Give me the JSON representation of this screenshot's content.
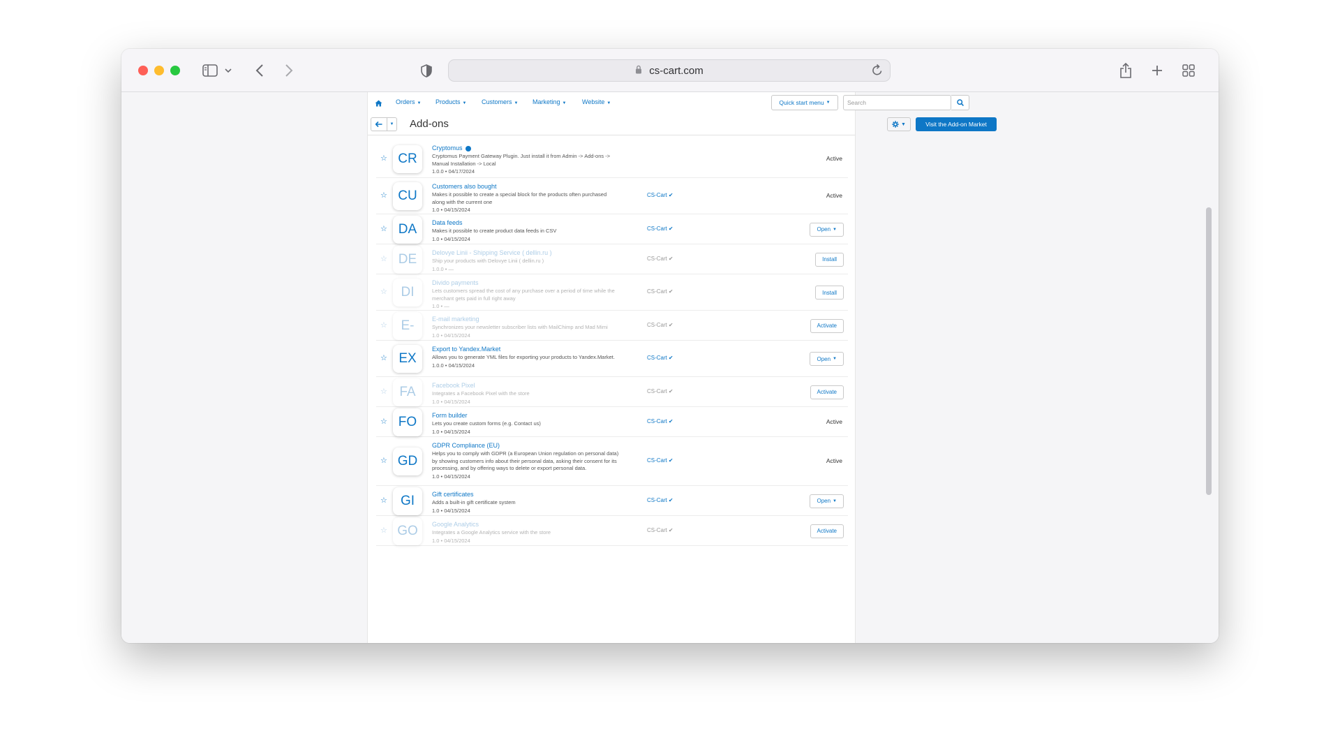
{
  "browser": {
    "url": "cs-cart.com"
  },
  "admin": {
    "nav": [
      {
        "label": "Orders"
      },
      {
        "label": "Products"
      },
      {
        "label": "Customers"
      },
      {
        "label": "Marketing"
      },
      {
        "label": "Website"
      }
    ],
    "quick_start_label": "Quick start menu",
    "search_placeholder": "Search",
    "page_title": "Add-ons",
    "visit_market_label": "Visit the Add-on Market"
  },
  "addons": [
    {
      "abbr": "CR",
      "name": "Cryptomus",
      "verified_dot": true,
      "desc": "Cryptomus Payment Gateway Plugin. Just install it from Admin -> Add-ons -> Manual Installation -> Local",
      "meta": "1.0.0 • 04/17/2024",
      "developer": "",
      "action_type": "text",
      "action": "Active",
      "enabled": true
    },
    {
      "abbr": "CU",
      "name": "Customers also bought",
      "desc": "Makes it possible to create a special block for the products often purchased along with the current one",
      "meta": "1.0 • 04/15/2024",
      "developer": "CS-Cart",
      "action_type": "text",
      "action": "Active",
      "enabled": true
    },
    {
      "abbr": "DA",
      "name": "Data feeds",
      "desc": "Makes it possible to create product data feeds in CSV",
      "meta": "1.0 • 04/15/2024",
      "developer": "CS-Cart",
      "action_type": "dropdown",
      "action": "Open",
      "enabled": true
    },
    {
      "abbr": "DE",
      "name": "Delovye Linii - Shipping Service ( dellin.ru )",
      "desc": "Ship your products with Delovye Linii ( dellin.ru )",
      "meta": "1.0.0 • —",
      "developer": "CS-Cart",
      "action_type": "button",
      "action": "Install",
      "enabled": false
    },
    {
      "abbr": "DI",
      "name": "Divido payments",
      "desc": "Lets customers spread the cost of any purchase over a period of time while the merchant gets paid in full right away",
      "meta": "1.0 • —",
      "developer": "CS-Cart",
      "action_type": "button",
      "action": "Install",
      "enabled": false
    },
    {
      "abbr": "E-",
      "name": "E-mail marketing",
      "desc": "Synchronizes your newsletter subscriber lists with MailChimp and Mad Mimi",
      "meta": "1.0 • 04/15/2024",
      "developer": "CS-Cart",
      "action_type": "button",
      "action": "Activate",
      "enabled": false
    },
    {
      "abbr": "EX",
      "name": "Export to Yandex.Market",
      "desc": "Allows you to generate YML files for exporting your products to Yandex.Market.",
      "meta": "1.0.0 • 04/15/2024",
      "developer": "CS-Cart",
      "action_type": "dropdown",
      "action": "Open",
      "enabled": true
    },
    {
      "abbr": "FA",
      "name": "Facebook Pixel",
      "desc": "Integrates a Facebook Pixel with the store",
      "meta": "1.0 • 04/15/2024",
      "developer": "CS-Cart",
      "action_type": "button",
      "action": "Activate",
      "enabled": false
    },
    {
      "abbr": "FO",
      "name": "Form builder",
      "desc": "Lets you create custom forms (e.g. Contact us)",
      "meta": "1.0 • 04/15/2024",
      "developer": "CS-Cart",
      "action_type": "text",
      "action": "Active",
      "enabled": true
    },
    {
      "abbr": "GD",
      "name": "GDPR Compliance (EU)",
      "desc": "Helps you to comply with GDPR (a European Union regulation on personal data) by showing customers info about their personal data, asking their consent for its processing, and by offering ways to delete or export personal data.",
      "meta": "1.0 • 04/15/2024",
      "developer": "CS-Cart",
      "action_type": "text",
      "action": "Active",
      "enabled": true
    },
    {
      "abbr": "GI",
      "name": "Gift certificates",
      "desc": "Adds a built-in gift certificate system",
      "meta": "1.0 • 04/15/2024",
      "developer": "CS-Cart",
      "action_type": "dropdown",
      "action": "Open",
      "enabled": true
    },
    {
      "abbr": "GO",
      "name": "Google Analytics",
      "desc": "Integrates a Google Analytics service with the store",
      "meta": "1.0 • 04/15/2024",
      "developer": "CS-Cart",
      "action_type": "button",
      "action": "Activate",
      "enabled": false
    }
  ]
}
